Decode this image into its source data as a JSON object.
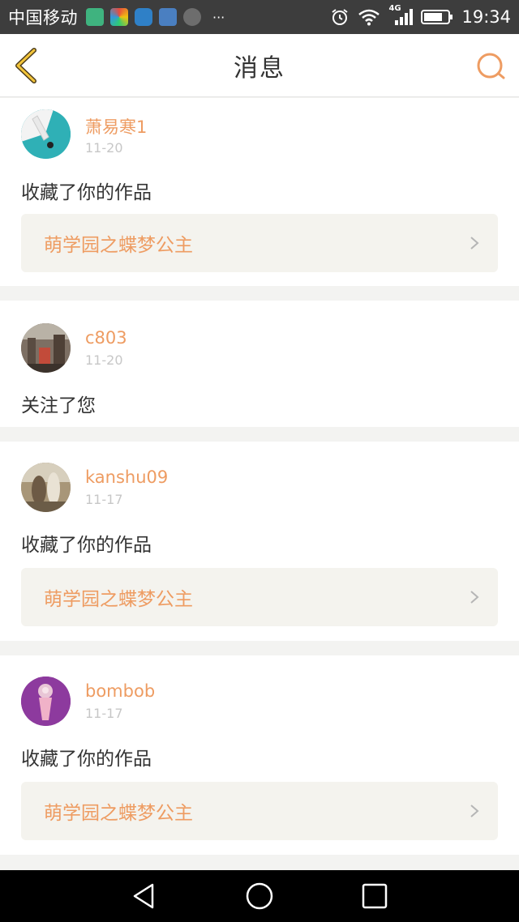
{
  "status_bar": {
    "carrier": "中国移动",
    "more": "···",
    "network": "4G",
    "time": "19:34",
    "notification_icons": [
      "app-icon-green",
      "app-icon-multicolor",
      "app-icon-blue",
      "app-icon-health",
      "app-icon-photo"
    ]
  },
  "header": {
    "title": "消息",
    "back_icon": "chevron-left-icon",
    "search_icon": "search-icon",
    "accent_color": "#ee9c62"
  },
  "messages": [
    {
      "username": "萧易寒1",
      "date": "11-20",
      "action": "收藏了你的作品",
      "work_title": "萌学园之蝶梦公主"
    },
    {
      "username": "c803",
      "date": "11-20",
      "action": "关注了您",
      "work_title": null
    },
    {
      "username": "kanshu09",
      "date": "11-17",
      "action": "收藏了你的作品",
      "work_title": "萌学园之蝶梦公主"
    },
    {
      "username": "bombob",
      "date": "11-17",
      "action": "收藏了你的作品",
      "work_title": "萌学园之蝶梦公主"
    }
  ],
  "nav_bar": {
    "back": "triangle-back-icon",
    "home": "circle-home-icon",
    "recents": "square-recents-icon"
  }
}
